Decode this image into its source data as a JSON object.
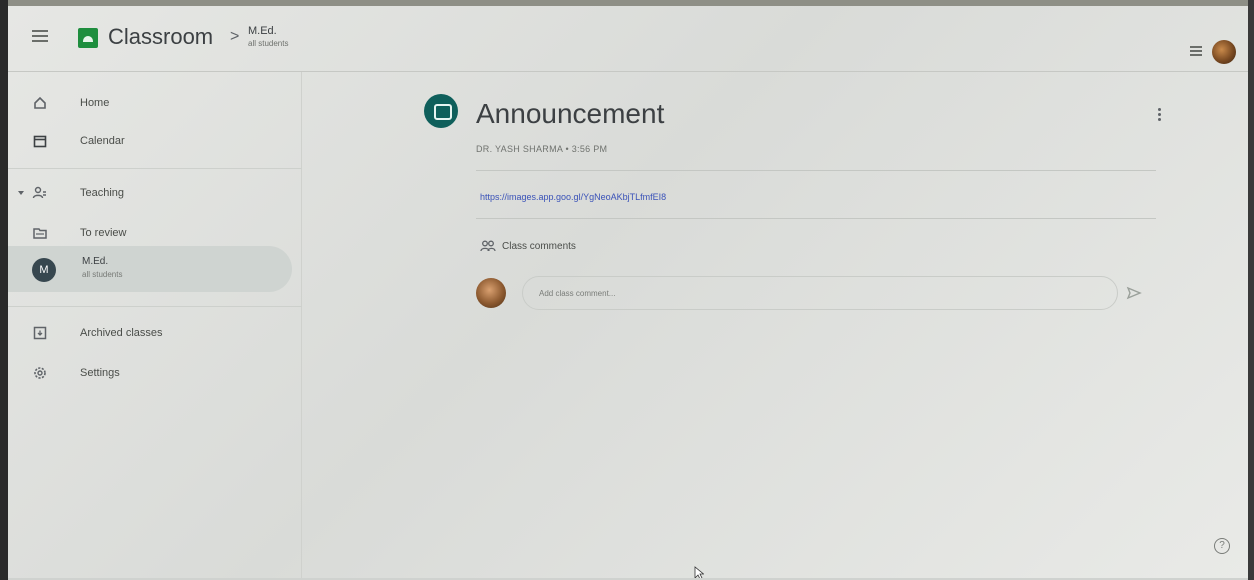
{
  "topbar": {
    "app_title": "Classroom",
    "breadcrumb_separator": ">",
    "class_name": "M.Ed.",
    "class_subtitle": "all students"
  },
  "sidebar": {
    "items": [
      {
        "label": "Home",
        "icon": "home-icon"
      },
      {
        "label": "Calendar",
        "icon": "calendar-icon"
      },
      {
        "label": "Teaching",
        "icon": "people-icon"
      },
      {
        "label": "To review",
        "icon": "folder-icon"
      },
      {
        "label": "Archived classes",
        "icon": "archive-icon"
      },
      {
        "label": "Settings",
        "icon": "gear-icon"
      }
    ],
    "active_class": {
      "badge": "M",
      "name": "M.Ed.",
      "subtitle": "all students"
    }
  },
  "post": {
    "title": "Announcement",
    "meta": "DR. YASH SHARMA • 3:56 PM",
    "link": "https://images.app.goo.gl/YgNeoAKbjTLfmfEI8",
    "comments_label": "Class comments",
    "comment_placeholder": "Add class comment..."
  },
  "colors": {
    "accent_green": "#1e8e3e",
    "post_icon": "#0f5f5b",
    "link": "#3a52b8"
  }
}
